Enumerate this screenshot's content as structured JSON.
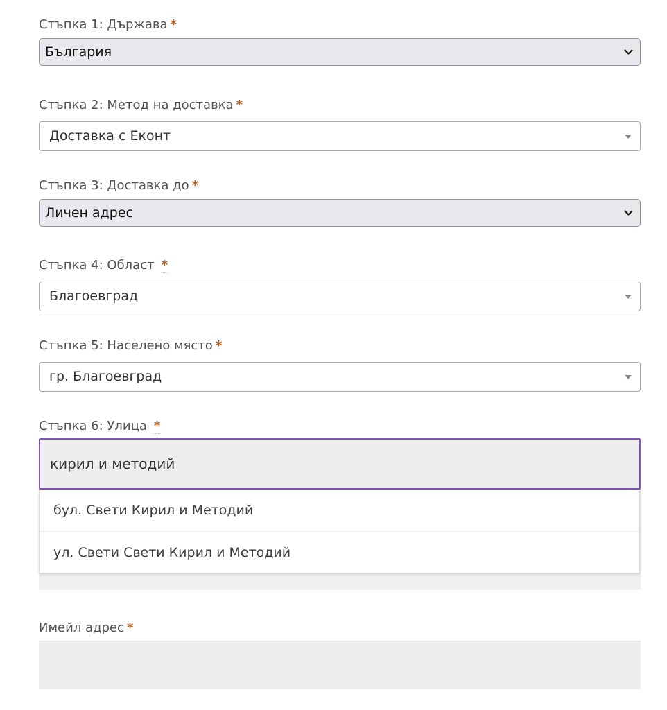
{
  "required_mark": "*",
  "step1": {
    "label": "Стъпка 1: Държава",
    "value": "България"
  },
  "step2": {
    "label": "Стъпка 2: Метод на доставка",
    "value": "Доставка с Еконт"
  },
  "step3": {
    "label": "Стъпка 3: Доставка до",
    "value": "Личен адрес"
  },
  "step4": {
    "label": "Стъпка 4: Област",
    "value": "Благоевград"
  },
  "step5": {
    "label": "Стъпка 5: Населено място",
    "value": "гр. Благоевград"
  },
  "step6": {
    "label": "Стъпка 6: Улица",
    "query": "кирил и методий",
    "suggestions": [
      "бул. Свети Кирил и Методий",
      "ул. Свети Свети Кирил и Методий"
    ]
  },
  "email": {
    "label": "Имейл адрес",
    "value": ""
  },
  "colors": {
    "required": "#b85c1e",
    "focus_border": "#7f54b3",
    "native_select_bg": "#e9e9ed"
  },
  "icons": {
    "native_select": "chevron-down-icon",
    "select2": "triangle-down-icon"
  }
}
